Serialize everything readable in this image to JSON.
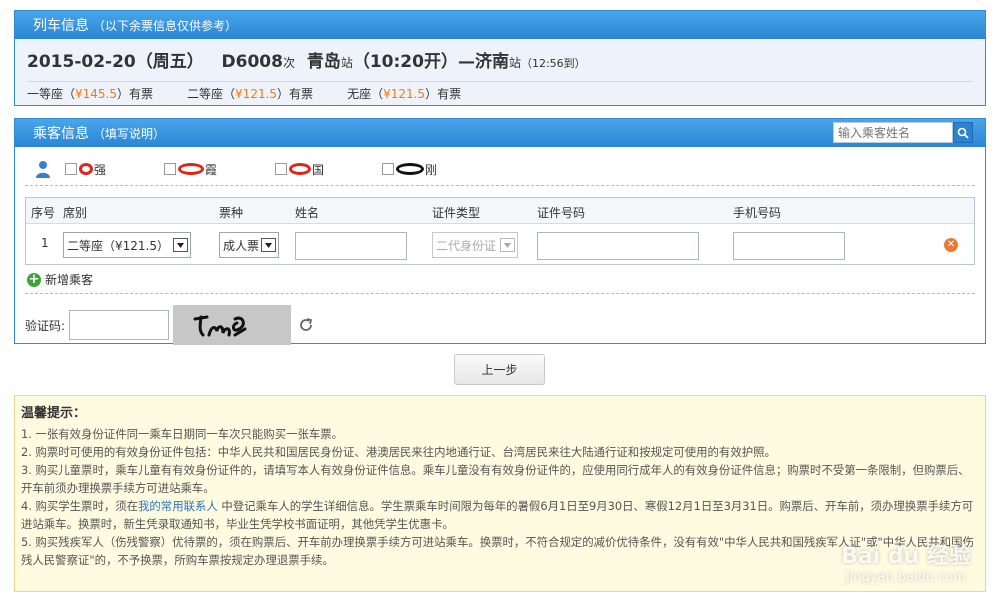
{
  "train_panel": {
    "title": "列车信息",
    "subtitle": "（以下余票信息仅供参考）",
    "date": "2015-02-20（周五）",
    "train_no": "D6008",
    "train_suffix": "次",
    "from_station": "青岛",
    "station_suffix_1": "站",
    "depart_time": "（10:20开）",
    "dash": "—",
    "to_station": "济南",
    "station_suffix_2": "站",
    "arrive_time": "（12:56到）",
    "seats": [
      {
        "name": "一等座（",
        "price": "¥145.5",
        "status": "）有票"
      },
      {
        "name": "二等座（",
        "price": "¥121.5",
        "status": "）有票"
      },
      {
        "name": "无座（",
        "price": "¥121.5",
        "status": "）有票"
      }
    ]
  },
  "passenger_panel": {
    "title": "乘客信息",
    "subtitle": "（填写说明）",
    "search_placeholder": "输入乘客姓名",
    "contacts": [
      {
        "label": "强"
      },
      {
        "label": "霞"
      },
      {
        "label": "国"
      },
      {
        "label": "刚"
      }
    ],
    "columns": [
      "序号",
      "席别",
      "票种",
      "姓名",
      "证件类型",
      "证件号码",
      "手机号码"
    ],
    "rows": [
      {
        "index": "1",
        "seat": "二等座（¥121.5）",
        "ticket_type": "成人票",
        "name": "",
        "id_type": "二代身份证",
        "id_no": "",
        "phone": ""
      }
    ],
    "add_label": "新增乘客",
    "captcha_label": "验证码:"
  },
  "prev_button": "上一步",
  "tips": {
    "title": "温馨提示：",
    "items": [
      "1. 一张有效身份证件同一乘车日期同一车次只能购买一张车票。",
      "2. 购票时可使用的有效身份证件包括：中华人民共和国居民身份证、港澳居民来往内地通行证、台湾居民来往大陆通行证和按规定可使用的有效护照。",
      "3. 购买儿童票时，乘车儿童有有效身份证件的，请填写本人有效身份证件信息。乘车儿童没有有效身份证件的，应使用同行成年人的有效身份证件信息；购票时不受第一条限制，但购票后、开车前须办理换票手续方可进站乘车。",
      "4. 购买学生票时，须在",
      "我的常用联系人",
      " 中登记乘车人的学生详细信息。学生票乘车时间限为每年的暑假6月1日至9月30日、寒假12月1日至3月31日。购票后、开车前，须办理换票手续方可进站乘车。换票时，新生凭录取通知书，毕业生凭学校书面证明，其他凭学生优惠卡。",
      "5. 购买残疾军人（伤残警察）优待票的，须在购票后、开车前办理换票手续方可进站乘车。换票时，不符合规定的减价优待条件，没有有效\"中华人民共和国残疾军人证\"或\"中华人民共和国伤残人民警察证\"的，不予换票，所购车票按规定办理退票手续。"
    ]
  },
  "watermark": {
    "brand": "Bai du 经验",
    "url": "jingyan.baidu.com"
  }
}
